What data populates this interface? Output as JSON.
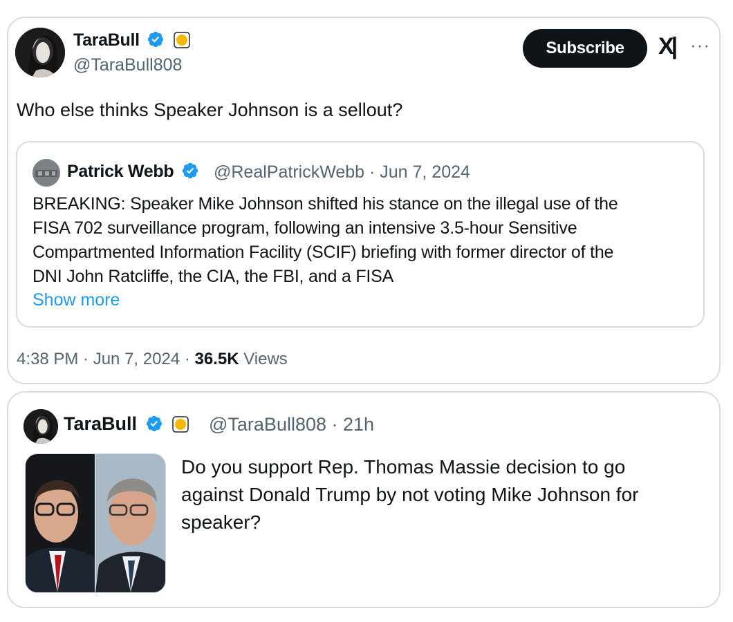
{
  "main_tweet": {
    "author_name": "TaraBull",
    "handle": "@TaraBull808",
    "subscribe_label": "Subscribe",
    "platform_logo": "x-logo",
    "more_label": "···",
    "text": "Who else thinks Speaker Johnson is a sellout?",
    "quoted": {
      "author_name": "Patrick Webb",
      "meta": "@RealPatrickWebb · Jun 7, 2024",
      "lines": [
        "BREAKING: Speaker Mike Johnson shifted his stance on the illegal use of the",
        "FISA 702 surveillance program, following an intensive 3.5-hour Sensitive",
        "Compartmented Information Facility (SCIF) briefing with former director of the",
        "DNI John Ratcliffe, the CIA, the FBI, and a FISA"
      ],
      "show_more": "Show more"
    },
    "footer": {
      "time": "4:38 PM · Jun 7, 2024 · ",
      "views_count": "36.5K",
      "views_label": " Views"
    }
  },
  "reply_tweet": {
    "author_name": "TaraBull",
    "meta": "@TaraBull808 · 21h",
    "lines": [
      "Do you support Rep. Thomas Massie decision to go",
      "against Donald Trump by not voting Mike Johnson for",
      "speaker?"
    ]
  },
  "colors": {
    "verified_blue": "#1d9bf0",
    "link_blue": "#1d9bf0",
    "secondary_text": "#536471",
    "border": "#d6dde3",
    "badge_gold": "#f5b800"
  },
  "icons": [
    "verified-badge-icon",
    "gold-emoji-icon",
    "x-logo-icon",
    "more-icon"
  ]
}
